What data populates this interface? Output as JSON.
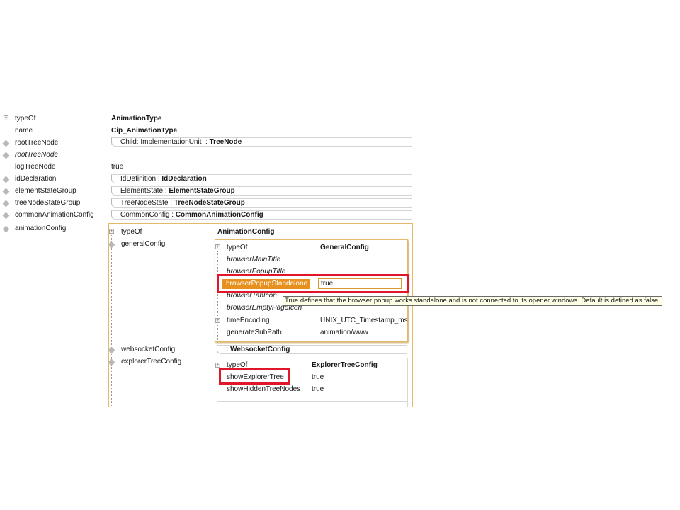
{
  "outer": {
    "rows": [
      {
        "key": "typeOf",
        "value": "AnimationType"
      },
      {
        "key": "name",
        "value": "Cip_AnimationType"
      },
      {
        "key": "rootTreeNode",
        "ref_prefix": "Child: ImplementationUnit",
        "ref_type": "TreeNode"
      },
      {
        "key": "rootTreeNode"
      },
      {
        "key": "logTreeNode",
        "value": "true"
      },
      {
        "key": "idDeclaration",
        "ref_prefix": "IdDefinition",
        "ref_type": "IdDeclaration"
      },
      {
        "key": "elementStateGroup",
        "ref_prefix": "ElementState",
        "ref_type": "ElementStateGroup"
      },
      {
        "key": "treeNodeStateGroup",
        "ref_prefix": "TreeNodeState",
        "ref_type": "TreeNodeStateGroup"
      },
      {
        "key": "commonAnimationConfig",
        "ref_prefix": "CommonConfig",
        "ref_type": "CommonAnimationConfig"
      },
      {
        "key": "animationConfig"
      }
    ]
  },
  "animation_config": {
    "typeOf_key": "typeOf",
    "typeOf_value": "AnimationConfig",
    "generalConfig_key": "generalConfig",
    "websocketConfig_key": "websocketConfig",
    "websocketConfig_ref": ": WebsocketConfig",
    "explorerTreeConfig_key": "explorerTreeConfig"
  },
  "general_config": {
    "typeOf_key": "typeOf",
    "typeOf_value": "GeneralConfig",
    "browserMainTitle": "browserMainTitle",
    "browserPopupTitle": "browserPopupTitle",
    "browserPopupStandalone": "browserPopupStandalone",
    "browserPopupStandalone_value": "true",
    "browserTabIcon": "browserTabIcon",
    "browserEmptyPageIcon": "browserEmptyPageIcon",
    "timeEncoding": "timeEncoding",
    "timeEncoding_value": "UNIX_UTC_Timestamp_ms",
    "generateSubPath": "generateSubPath",
    "generateSubPath_value": "animation/www"
  },
  "explorer_config": {
    "typeOf_key": "typeOf",
    "typeOf_value": "ExplorerTreeConfig",
    "showExplorerTree": "showExplorerTree",
    "showExplorerTree_value": "true",
    "showHiddenTreeNodes": "showHiddenTreeNodes",
    "showHiddenTreeNodes_value": "true"
  },
  "tooltip": "True defines that the browser popup works standalone and is not connected to its opener windows. Default is defined as false.",
  "colors": {
    "selection": "#e8901e",
    "highlight_box": "#e0162b",
    "panel_border": "#e6b96a",
    "tooltip_bg": "#ffffe6"
  }
}
